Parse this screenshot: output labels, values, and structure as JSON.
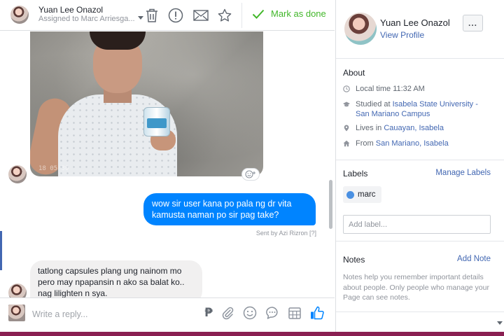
{
  "conversation": {
    "customer_name": "Yuan Lee Onazol",
    "assigned_to": "Assigned to Marc Arriesga...",
    "mark_done_label": "Mark as done",
    "accent_color": "#42b72a"
  },
  "messages": {
    "photo_timestamp": "18 05 30",
    "outgoing_text": "wow sir user kana po pala ng dr vita kamusta naman po sir pag take?",
    "sent_by": "Sent by Azi Rizron",
    "sent_by_hint": "[?]",
    "incoming_text": "tatlong capsules plang ung  nainom mo pero may npapansin n ako sa balat ko.. nag lilighten n sya.",
    "outgoing_color": "#0084ff"
  },
  "composer": {
    "placeholder": "Write a reply...",
    "currency_glyph": "₱"
  },
  "profile": {
    "name": "Yuan Lee Onazol",
    "view_profile": "View Profile",
    "more_label": "..."
  },
  "about": {
    "title": "About",
    "local_time": "Local time 11:32 AM",
    "studied_prefix": "Studied at ",
    "studied_at": "Isabela State University - San Mariano Campus",
    "lives_prefix": "Lives in ",
    "lives_in": "Cauayan, Isabela",
    "from_prefix": "From ",
    "from": "San Mariano, Isabela"
  },
  "labels": {
    "title": "Labels",
    "manage": "Manage Labels",
    "items": [
      "marc"
    ],
    "add_placeholder": "Add label..."
  },
  "notes": {
    "title": "Notes",
    "add": "Add Note",
    "help": "Notes help you remember important details about people. Only people who manage your Page can see notes."
  }
}
